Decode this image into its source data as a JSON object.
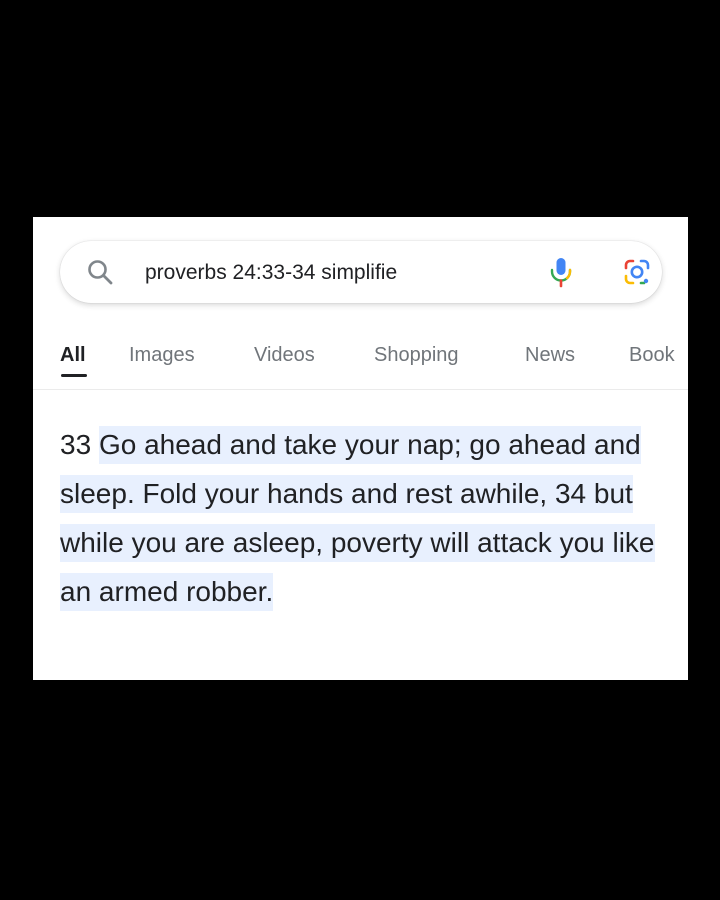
{
  "search": {
    "query": "proverbs 24:33-34 simplifie",
    "icons": {
      "search": "search-icon",
      "voice": "mic-icon",
      "lens": "google-lens-icon"
    },
    "colors": {
      "blue": "#4285f4",
      "red": "#ea4335",
      "yellow": "#fbbc04",
      "green": "#34a853"
    }
  },
  "tabs": [
    {
      "label": "All",
      "active": true
    },
    {
      "label": "Images",
      "active": false
    },
    {
      "label": "Videos",
      "active": false
    },
    {
      "label": "Shopping",
      "active": false
    },
    {
      "label": "News",
      "active": false
    },
    {
      "label": "Book",
      "active": false
    }
  ],
  "result": {
    "verse_number": "33",
    "highlighted_text": "Go ahead and take your nap; go ahead and sleep. Fold your hands and rest awhile, 34 but while you are asleep, poverty will attack you like an armed robber.",
    "highlight_color": "#e8f0fe"
  }
}
